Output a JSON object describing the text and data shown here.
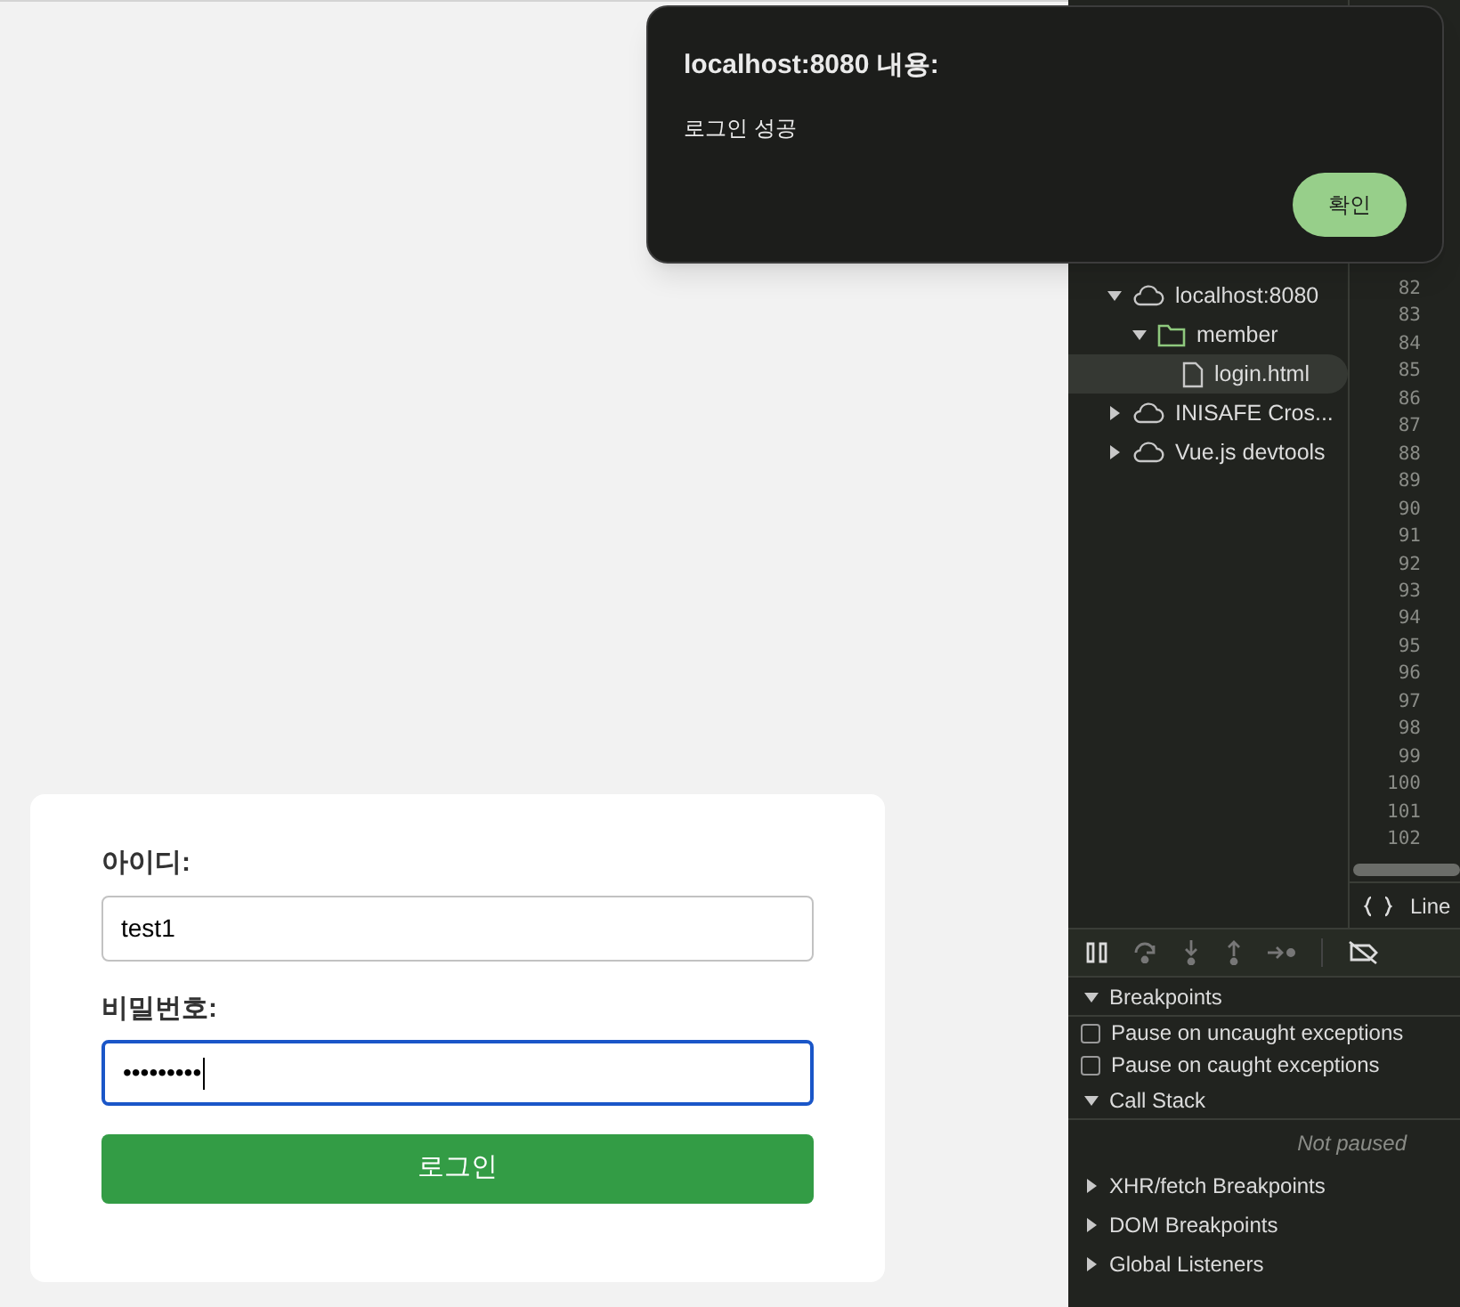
{
  "login_form": {
    "fields": [
      {
        "label": "아이디:",
        "value": "test1",
        "focused": false
      },
      {
        "label": "비밀번호:",
        "value": "•••••••••",
        "focused": true
      }
    ],
    "submit": "로그인"
  },
  "devtools": {
    "file_tree": [
      {
        "label": "localhost:8080",
        "kind": "origin",
        "expanded": true,
        "selected": false,
        "children": [
          {
            "label": "member",
            "kind": "folder",
            "expanded": true,
            "selected": false,
            "children": [
              {
                "label": "login.html",
                "kind": "file",
                "selected": true
              }
            ]
          }
        ]
      },
      {
        "label": "INISAFE Cros...",
        "kind": "origin",
        "expanded": false,
        "selected": false
      },
      {
        "label": "Vue.js devtools",
        "kind": "origin",
        "expanded": false,
        "selected": false
      }
    ],
    "line_numbers": [
      "82",
      "83",
      "84",
      "85",
      "86",
      "87",
      "88",
      "89",
      "90",
      "91",
      "92",
      "93",
      "94",
      "95",
      "96",
      "97",
      "98",
      "99",
      "100",
      "101",
      "102"
    ],
    "status_label": "Line",
    "sections": [
      {
        "kind": "header",
        "label": "Breakpoints",
        "expanded": true
      },
      {
        "kind": "checkbox",
        "label": "Pause on uncaught exceptions",
        "checked": false
      },
      {
        "kind": "checkbox",
        "label": "Pause on caught exceptions",
        "checked": false
      },
      {
        "kind": "header",
        "label": "Call Stack",
        "expanded": true
      },
      {
        "kind": "note",
        "label": "Not paused"
      },
      {
        "kind": "header",
        "label": "XHR/fetch Breakpoints",
        "expanded": false
      },
      {
        "kind": "header",
        "label": "DOM Breakpoints",
        "expanded": false
      },
      {
        "kind": "header",
        "label": "Global Listeners",
        "expanded": false
      }
    ]
  },
  "alert": {
    "title": "localhost:8080 내용:",
    "message": "로그인 성공",
    "button": "확인"
  }
}
